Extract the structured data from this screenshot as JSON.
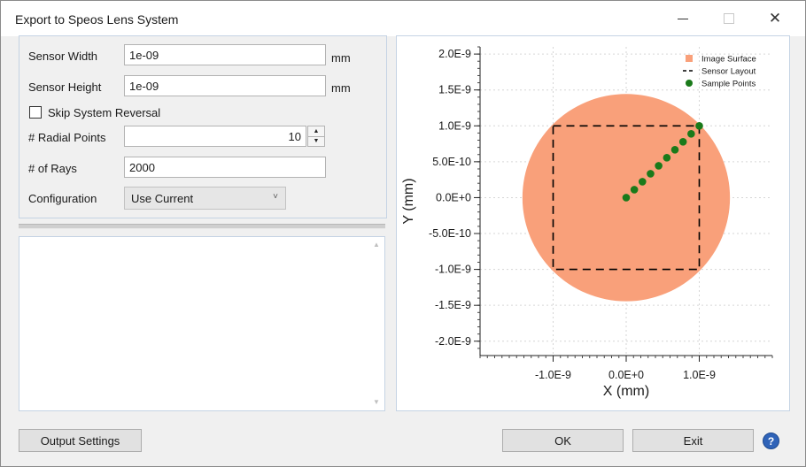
{
  "window": {
    "title": "Export to Speos Lens System"
  },
  "form": {
    "sensor_width": {
      "label": "Sensor Width",
      "value": "1e-09",
      "unit": "mm"
    },
    "sensor_height": {
      "label": "Sensor Height",
      "value": "1e-09",
      "unit": "mm"
    },
    "skip_reversal": {
      "label": "Skip System Reversal",
      "checked": false
    },
    "radial_points": {
      "label": "# Radial Points",
      "value": "10"
    },
    "rays": {
      "label": "# of Rays",
      "value": "2000"
    },
    "configuration": {
      "label": "Configuration",
      "value": "Use Current"
    }
  },
  "buttons": {
    "output_settings": "Output Settings",
    "ok": "OK",
    "exit": "Exit",
    "help": "?"
  },
  "chart_data": {
    "type": "scatter",
    "xlabel": "X (mm)",
    "ylabel": "Y (mm)",
    "xlim": [
      -2e-09,
      2e-09
    ],
    "ylim": [
      -2.2e-09,
      2.1e-09
    ],
    "xticks": [
      -1e-09,
      0.0,
      1e-09
    ],
    "xtick_labels": [
      "-1.0E-9",
      "0.0E+0",
      "1.0E-9"
    ],
    "yticks": [
      2e-09,
      1.5e-09,
      1e-09,
      5e-10,
      0.0,
      -5e-10,
      -1e-09,
      -1.5e-09,
      -2e-09
    ],
    "ytick_labels": [
      "2.0E-9",
      "1.5E-9",
      "1.0E-9",
      "5.0E-10",
      "0.0E+0",
      "-5.0E-10",
      "-1.0E-9",
      "-1.5E-9",
      "-2.0E-9"
    ],
    "grid": true,
    "legend_position": "top-right",
    "legend": [
      {
        "name": "Image Surface",
        "color": "#f9a07a",
        "marker": "square"
      },
      {
        "name": "Sensor Layout",
        "color": "#000000",
        "marker": "dash"
      },
      {
        "name": "Sample Points",
        "color": "#1a7a1a",
        "marker": "circle"
      }
    ],
    "image_surface": {
      "center": [
        0,
        0
      ],
      "radius": 1.42e-09
    },
    "sensor_layout": {
      "x": [
        -1e-09,
        1e-09
      ],
      "y": [
        -1e-09,
        1e-09
      ]
    },
    "sample_points": {
      "x": [
        0.0,
        1.11e-10,
        2.22e-10,
        3.33e-10,
        4.44e-10,
        5.56e-10,
        6.67e-10,
        7.78e-10,
        8.89e-10,
        1e-09
      ],
      "y": [
        0.0,
        1.11e-10,
        2.22e-10,
        3.33e-10,
        4.44e-10,
        5.56e-10,
        6.67e-10,
        7.78e-10,
        8.89e-10,
        1e-09
      ]
    }
  }
}
